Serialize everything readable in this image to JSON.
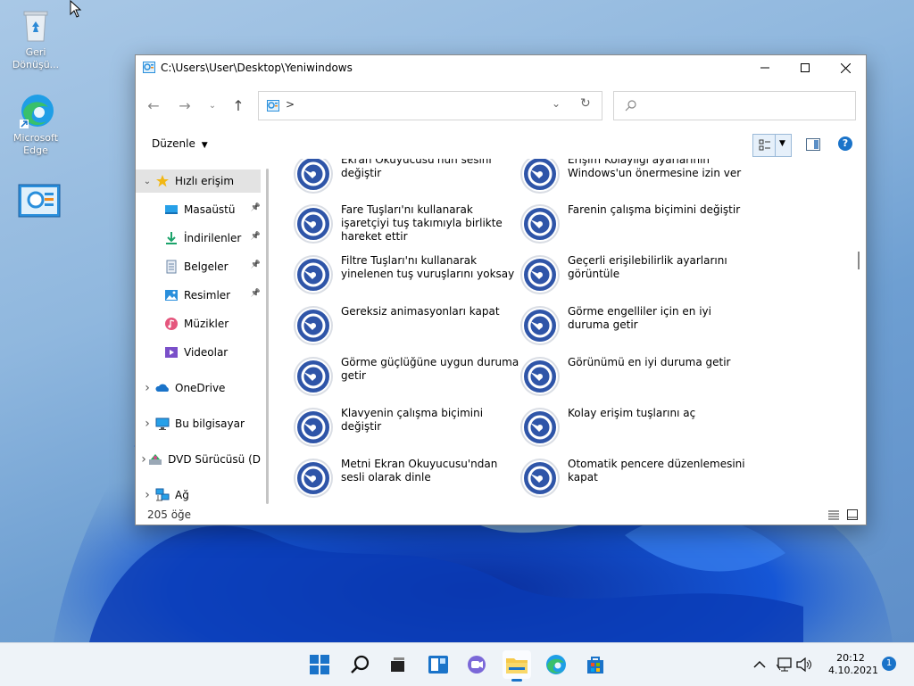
{
  "desktop": {
    "icons": [
      {
        "label": "Geri Dönüşü..."
      },
      {
        "label": "Microsoft Edge"
      },
      {
        "label": ""
      }
    ]
  },
  "window": {
    "title": "C:\\Users\\User\\Desktop\\Yeniwindows",
    "address_chevron": ">",
    "search_placeholder": "",
    "organize_label": "Düzenle"
  },
  "sidebar": {
    "items": [
      {
        "label": "Hızlı erişim",
        "icon": "star-icon",
        "selected": true,
        "expandable": true
      },
      {
        "label": "Masaüstü",
        "icon": "desktop-folder-icon",
        "pinned": true
      },
      {
        "label": "İndirilenler",
        "icon": "download-icon",
        "pinned": true
      },
      {
        "label": "Belgeler",
        "icon": "documents-icon",
        "pinned": true
      },
      {
        "label": "Resimler",
        "icon": "pictures-icon",
        "pinned": true
      },
      {
        "label": "Müzikler",
        "icon": "music-icon"
      },
      {
        "label": "Videolar",
        "icon": "videos-icon"
      },
      {
        "label": "OneDrive",
        "icon": "onedrive-icon",
        "expandable": true
      },
      {
        "label": "Bu bilgisayar",
        "icon": "this-pc-icon",
        "expandable": true
      },
      {
        "label": "DVD Sürücüsü (D",
        "icon": "dvd-drive-icon",
        "expandable": true
      },
      {
        "label": "Ağ",
        "icon": "network-icon",
        "expandable": true
      }
    ]
  },
  "content": {
    "items": [
      {
        "label": "Ekran Okuyucusu'nun sesini değiştir"
      },
      {
        "label": "Erişim Kolaylığı ayarlarının Windows'un önermesine izin ver"
      },
      {
        "label": "Fare Tuşları'nı kullanarak işaretçiyi tuş takımıyla birlikte hareket ettir"
      },
      {
        "label": "Farenin çalışma biçimini değiştir"
      },
      {
        "label": "Filtre Tuşları'nı kullanarak yinelenen tuş vuruşlarını yoksay"
      },
      {
        "label": "Geçerli erişilebilirlik ayarlarını görüntüle"
      },
      {
        "label": "Gereksiz animasyonları kapat"
      },
      {
        "label": "Görme engelliler için en iyi duruma getir"
      },
      {
        "label": "Görme güçlüğüne uygun duruma getir"
      },
      {
        "label": "Görünümü en iyi duruma getir"
      },
      {
        "label": "Klavyenin çalışma biçimini değiştir"
      },
      {
        "label": "Kolay erişim tuşlarını aç"
      },
      {
        "label": "Metni Ekran Okuyucusu'ndan sesli olarak dinle"
      },
      {
        "label": "Otomatik pencere düzenlemesini kapat"
      }
    ]
  },
  "status": {
    "item_count": "205 öğe"
  },
  "taskbar": {
    "time": "20:12",
    "date": "4.10.2021",
    "notification_count": "1"
  },
  "colors": {
    "accent": "#1a73c9",
    "icon_blue": "#2f55a8"
  }
}
